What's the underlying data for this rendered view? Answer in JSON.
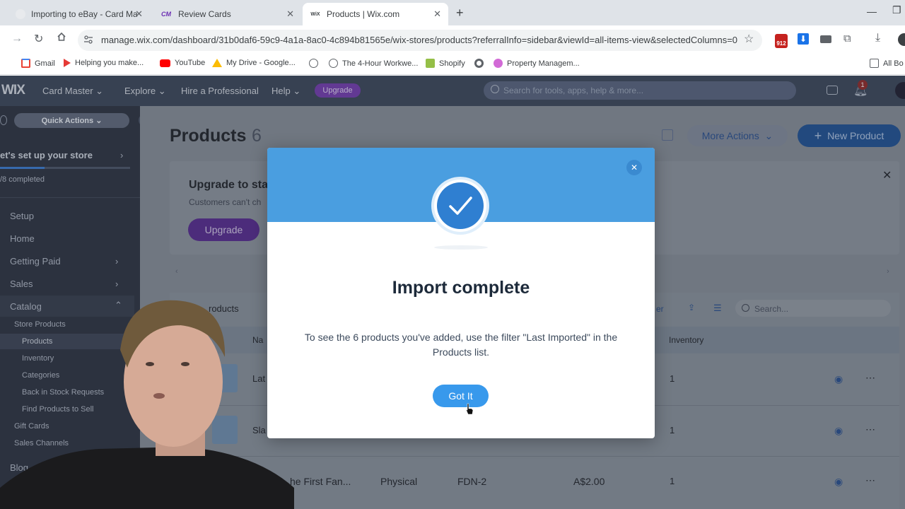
{
  "browser": {
    "tabs": [
      {
        "title": "Importing to eBay - Card Maste",
        "favicon": "ebay-icon"
      },
      {
        "title": "Review Cards",
        "favicon": "cm-icon",
        "fav_text": "CM"
      },
      {
        "title": "Products | Wix.com",
        "favicon": "wix-icon",
        "fav_text": "WiX"
      }
    ],
    "new_tab": "+",
    "url": "manage.wix.com/dashboard/31b0daf6-59c9-4a1a-8ac0-4c894b81565e/wix-stores/products?referralInfo=sidebar&viewId=all-items-view&selectedColumns=0%2C...",
    "bookmarks": [
      "Gmail",
      "Helping you make...",
      "YouTube",
      "My Drive - Google...",
      "The 4-Hour Workwe...",
      "Shopify",
      "Property Managem...",
      "All Bo"
    ],
    "ext_badge": "912"
  },
  "wix": {
    "logo": "WIX",
    "site_name": "Card Master",
    "nav": [
      "Explore",
      "Hire a Professional",
      "Help"
    ],
    "upgrade": "Upgrade",
    "search_placeholder": "Search for tools, apps, help & more...",
    "notif_count": "1"
  },
  "sidebar": {
    "quick_actions": "Quick Actions",
    "setup_title": "et's set up your store",
    "progress_text": "/8 completed",
    "items": [
      "Setup",
      "Home",
      "Getting Paid",
      "Sales",
      "Catalog"
    ],
    "catalog_children": [
      "Store Products",
      "Products",
      "Inventory",
      "Categories",
      "Back in Stock Requests",
      "Find Products to Sell",
      "Gift Cards",
      "Sales Channels"
    ],
    "blog": "Blog"
  },
  "main": {
    "title": "Products",
    "count": "6",
    "more_actions": "More Actions",
    "new_product": "New Product",
    "banner_title": "Upgrade to sta",
    "banner_text": "Customers can't ch",
    "banner_button": "Upgrade",
    "table_label": "roducts",
    "filter_label": "er",
    "table_search": "Search...",
    "columns": {
      "name": "Na",
      "inventory": "Inventory"
    },
    "rows": [
      {
        "name": "Lat",
        "type": "",
        "sku": "",
        "price": "",
        "inventory": "1"
      },
      {
        "name": "Sla",
        "type": "",
        "sku": "",
        "price": "",
        "inventory": "1"
      },
      {
        "name": "he First Fan...",
        "type": "Physical",
        "sku": "FDN-2",
        "price": "A$2.00",
        "inventory": "1"
      }
    ]
  },
  "modal": {
    "title": "Import complete",
    "message": "To see the 6 products you've added, use the filter \"Last Imported\" in the Products list.",
    "button": "Got It",
    "header_color": "#4a9ee0",
    "button_color": "#3899ec"
  }
}
